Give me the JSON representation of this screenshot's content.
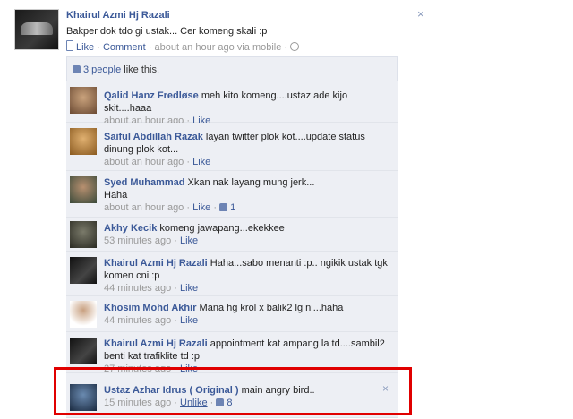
{
  "post": {
    "author": "Khairul Azmi Hj Razali",
    "text": "Bakper dok tdo gi ustak... Cer komeng skali :p",
    "like_label": "Like",
    "separator": "·",
    "comment_label": "Comment",
    "time": "about an hour ago via mobile",
    "close_glyph": "×"
  },
  "likes": {
    "count_text": "3 people",
    "suffix": " like this."
  },
  "comments": [
    {
      "name": "Qalid Hanz Fredløse",
      "text": "meh kito komeng....ustaz ade kijo skit....haaa",
      "time": "about an hour ago",
      "like": "Like",
      "likes": ""
    },
    {
      "name": "Saiful Abdillah Razak",
      "text": "layan twitter plok kot....update status dinung plok kot...",
      "time": "about an hour ago",
      "like": "Like",
      "likes": ""
    },
    {
      "name": "Syed Muhammad",
      "text": "Xkan nak layang mung jerk...",
      "text2": "Haha",
      "time": "about an hour ago",
      "like": "Like",
      "likes": "1"
    },
    {
      "name": "Akhy Kecik",
      "text": "komeng jawapang...ekekkee",
      "time": "53 minutes ago",
      "like": "Like",
      "likes": ""
    },
    {
      "name": "Khairul Azmi Hj Razali",
      "text": "Haha...sabo menanti :p.. ngikik ustak tgk komen cni :p",
      "time": "44 minutes ago",
      "like": "Like",
      "likes": ""
    },
    {
      "name": "Khosim Mohd Akhir",
      "text": "Mana hg krol x balik2 lg ni...haha",
      "time": "44 minutes ago",
      "like": "Like",
      "likes": ""
    },
    {
      "name": "Khairul Azmi Hj Razali",
      "text": "appointment kat ampang la td....sambil2 benti kat trafiklite td :p",
      "time": "27 minutes ago",
      "like": "Like",
      "likes": ""
    },
    {
      "name": "Ustaz Azhar Idrus ( Original )",
      "text": "main angry bird..",
      "time": "15 minutes ago",
      "like": "Unlike",
      "likes": "8"
    }
  ]
}
